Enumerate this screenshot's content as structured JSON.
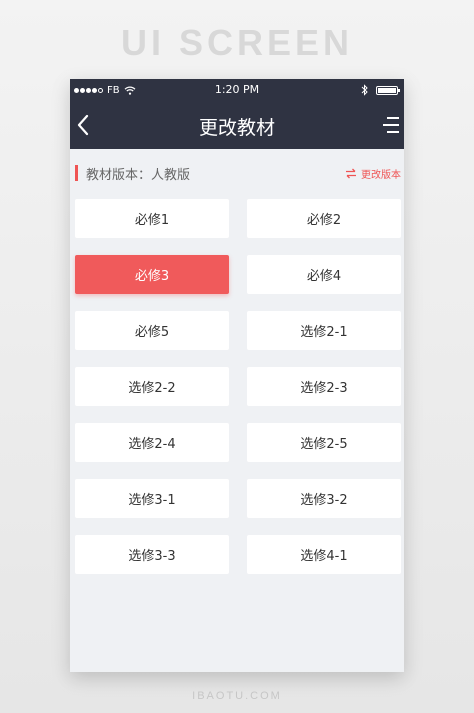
{
  "showcase_title": "UI SCREEN",
  "footer_mark": "IBAOTU.COM",
  "status_bar": {
    "carrier": "FB",
    "time": "1:20 PM",
    "signal_filled": 4,
    "signal_total": 5,
    "battery_level": 1.0
  },
  "nav": {
    "title": "更改教材",
    "back_icon": "chevron-left-icon",
    "menu_icon": "menu-icon"
  },
  "version": {
    "label": "教材版本：人教版",
    "change_label": "更改版本",
    "change_icon": "swap-arrows-icon"
  },
  "options": [
    {
      "label": "必修1",
      "selected": false
    },
    {
      "label": "必修2",
      "selected": false
    },
    {
      "label": "必修3",
      "selected": true
    },
    {
      "label": "必修4",
      "selected": false
    },
    {
      "label": "必修5",
      "selected": false
    },
    {
      "label": "选修2-1",
      "selected": false
    },
    {
      "label": "选修2-2",
      "selected": false
    },
    {
      "label": "选修2-3",
      "selected": false
    },
    {
      "label": "选修2-4",
      "selected": false
    },
    {
      "label": "选修2-5",
      "selected": false
    },
    {
      "label": "选修3-1",
      "selected": false
    },
    {
      "label": "选修3-2",
      "selected": false
    },
    {
      "label": "选修3-3",
      "selected": false
    },
    {
      "label": "选修4-1",
      "selected": false
    }
  ],
  "colors": {
    "header": "#2f3342",
    "accent": "#f05a5b",
    "background": "#eff1f4"
  }
}
